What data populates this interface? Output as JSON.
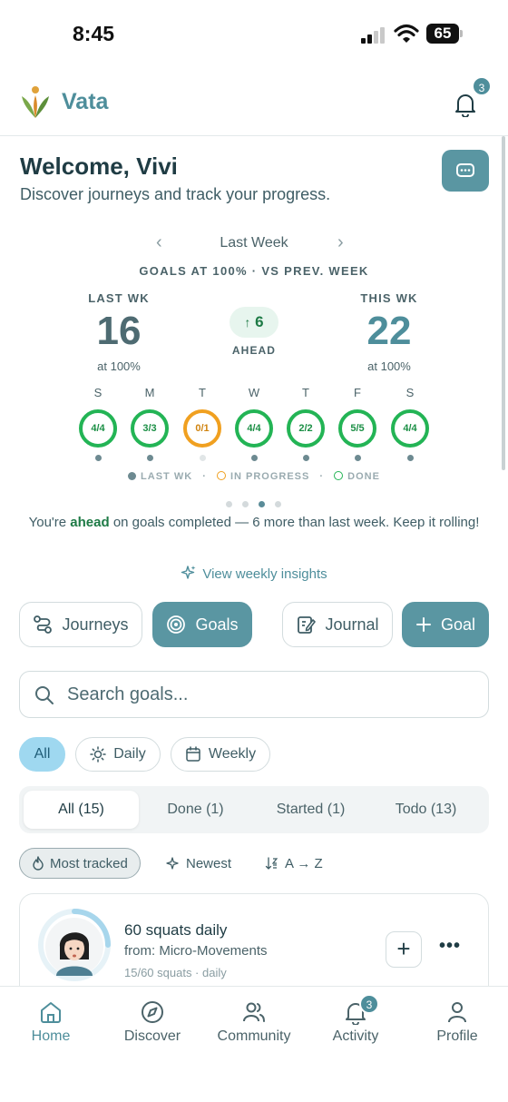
{
  "status": {
    "time": "8:45",
    "battery": "65"
  },
  "header": {
    "brand": "Vata",
    "notification_count": "3"
  },
  "welcome": {
    "title": "Welcome, Vivi",
    "subtitle": "Discover journeys and track your progress."
  },
  "week": {
    "label": "Last Week",
    "caption": "GOALS AT 100% · VS PREV. WEEK"
  },
  "comparison": {
    "last_label": "LAST WK",
    "last_value": "16",
    "last_sub": "at 100%",
    "this_label": "THIS WK",
    "this_value": "22",
    "this_sub": "at 100%",
    "delta": "6",
    "delta_label": "AHEAD"
  },
  "days": [
    {
      "letter": "S",
      "value": "4/4",
      "state": "done",
      "last_week": true
    },
    {
      "letter": "M",
      "value": "3/3",
      "state": "done",
      "last_week": true
    },
    {
      "letter": "T",
      "value": "0/1",
      "state": "in-progress",
      "last_week": false
    },
    {
      "letter": "W",
      "value": "4/4",
      "state": "done",
      "last_week": true
    },
    {
      "letter": "T",
      "value": "2/2",
      "state": "done",
      "last_week": true
    },
    {
      "letter": "F",
      "value": "5/5",
      "state": "done",
      "last_week": true
    },
    {
      "letter": "S",
      "value": "4/4",
      "state": "done",
      "last_week": true
    }
  ],
  "legend": {
    "last": "LAST WK",
    "progress": "IN PROGRESS",
    "done": "DONE"
  },
  "colors": {
    "accent": "#5a96a2",
    "done": "#23b455",
    "in_progress": "#f0a020",
    "ahead": "#1d7a45",
    "chip_active": "#9fd8f0"
  },
  "message": {
    "prefix": "You're ",
    "highlight": "ahead",
    "suffix": " on goals completed — 6 more than last week. Keep it rolling!"
  },
  "insights_link": "View weekly insights",
  "segments": {
    "journeys": "Journeys",
    "goals": "Goals",
    "journal": "Journal",
    "add_goal": "Goal"
  },
  "search": {
    "placeholder": "Search goals..."
  },
  "filters": {
    "all": "All",
    "daily": "Daily",
    "weekly": "Weekly"
  },
  "tabs": [
    "All (15)",
    "Done (1)",
    "Started (1)",
    "Todo (13)"
  ],
  "sort": {
    "most_tracked": "Most tracked",
    "newest": "Newest",
    "az": "A → Z"
  },
  "goal": {
    "title": "60 squats daily",
    "from": "from: Micro-Movements",
    "meta": "15/60 squats · daily",
    "progress": 0.25
  },
  "nav": {
    "home": "Home",
    "discover": "Discover",
    "community": "Community",
    "activity": "Activity",
    "activity_badge": "3",
    "profile": "Profile"
  }
}
